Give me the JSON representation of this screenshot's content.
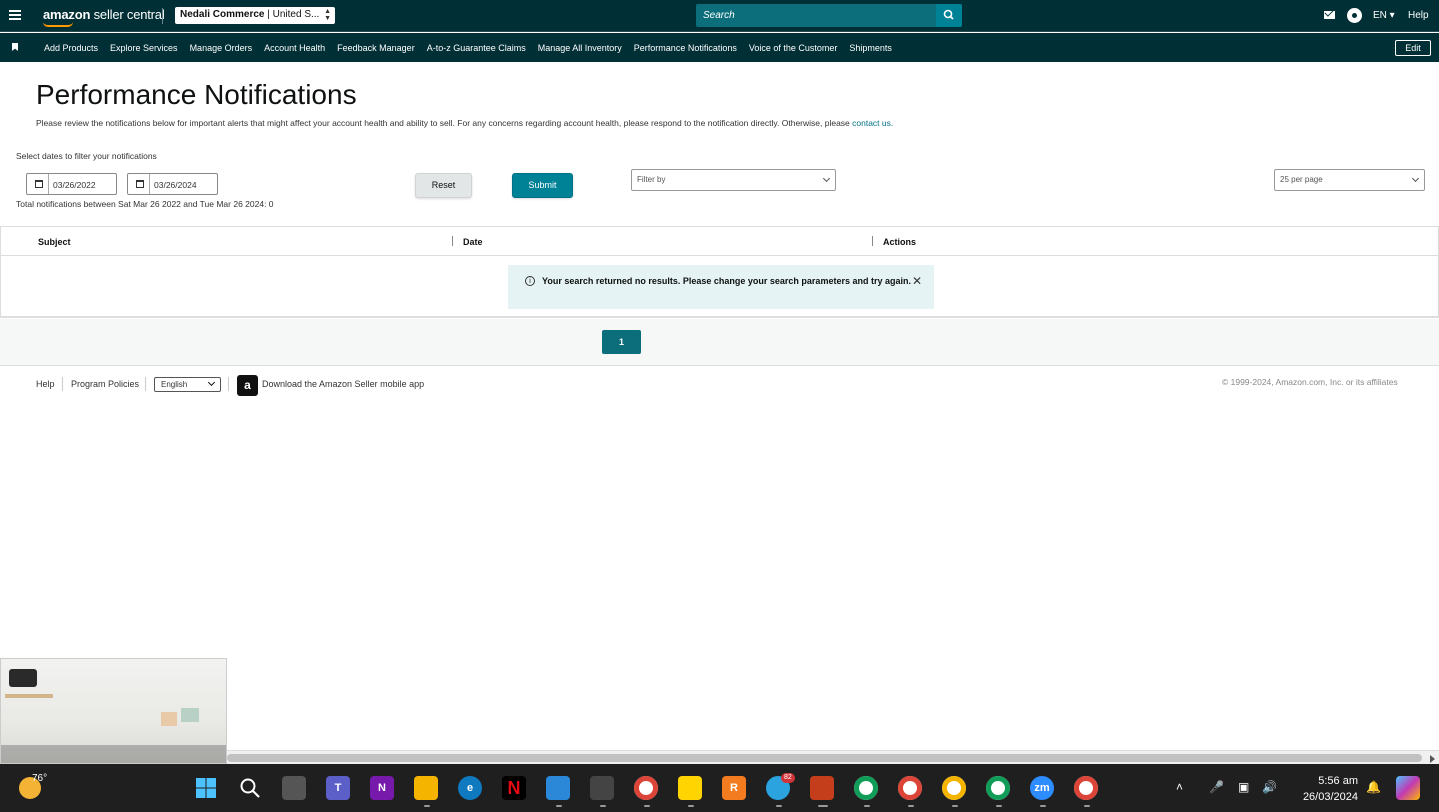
{
  "topbar": {
    "logo_prefix": "amazon",
    "logo_suffix": "seller central",
    "store_bold": "Nedali Commerce",
    "store_rest": " | United S...",
    "search_placeholder": "Search",
    "language": "EN ▾",
    "help": "Help"
  },
  "nav": {
    "items": [
      "Add Products",
      "Explore Services",
      "Manage Orders",
      "Account Health",
      "Feedback Manager",
      "A-to-z Guarantee Claims",
      "Manage All Inventory",
      "Performance Notifications",
      "Voice of the Customer",
      "Shipments"
    ],
    "edit": "Edit"
  },
  "page": {
    "title": "Performance Notifications",
    "intro": "Please review the notifications below for important alerts that might affect your account health and ability to sell. For any concerns regarding account health, please respond to the notification directly. Otherwise, please ",
    "intro_link": "contact us.",
    "filter_label": "Select dates to filter your notifications",
    "date_from": "03/26/2022",
    "date_to": "03/26/2024",
    "reset": "Reset",
    "submit": "Submit",
    "filter_by": "Filter by",
    "per_page": "25 per page",
    "total": "Total notifications between Sat Mar 26 2022 and Tue Mar 26 2024: 0"
  },
  "table": {
    "columns": [
      "Subject",
      "Date",
      "Actions"
    ],
    "empty_message": "Your search returned no results. Please change your search parameters and try again."
  },
  "pagination": {
    "current": "1"
  },
  "footer": {
    "help": "Help",
    "policies": "Program Policies",
    "language": "English",
    "app_link": "Download the Amazon Seller mobile app",
    "copyright": "© 1999-2024, Amazon.com, Inc. or its affiliates"
  },
  "taskbar": {
    "temperature": "76°",
    "telegram_badge": "82",
    "time": "5:56 am",
    "date": "26/03/2024"
  },
  "colors": {
    "header_bg": "#002f36",
    "accent": "#008296",
    "alert_bg": "#e6f3f4"
  }
}
